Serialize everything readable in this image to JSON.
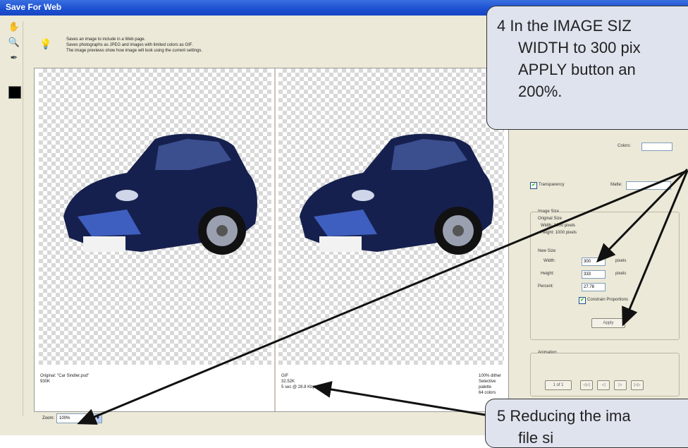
{
  "window": {
    "title": "Save For Web"
  },
  "info": {
    "lines": [
      "Saves an image to include in a Web page.",
      "Saves photographs as JPEG and images with limited colors as GIF.",
      "The image previews show how image will look using the current settings."
    ]
  },
  "preview": {
    "original": {
      "line1": "Original: \"Car Sindler.psd\"",
      "line2": "930K"
    },
    "optimized": {
      "line1": "GIF",
      "line2": "32.52K",
      "line3": "5 sec @ 28.8 Kbps"
    },
    "optimized_right": {
      "line1": "100% dither",
      "line2": "Selective palette",
      "line3": "64 colors"
    }
  },
  "settings": {
    "colors_label": "Colors:",
    "transparency_label": "Transparency",
    "matte_label": "Matte:",
    "image_size_label": "Image Size",
    "original_size_label": "Original Size",
    "orig_width": "Width: 1000 pixels",
    "orig_height": "Height: 1000 pixels",
    "new_size_label": "New Size",
    "width_label": "Width:",
    "width_value": "300",
    "height_label": "Height:",
    "height_value": "333",
    "percent_label": "Percent:",
    "percent_value": "27.78",
    "pixels_unit": "pixels",
    "constrain_label": "Constrain Proportions",
    "apply_button": "Apply",
    "animation_label": "Animation",
    "frame_label": "1 of 1"
  },
  "zoom": {
    "label": "Zoom:",
    "value": "100%"
  },
  "callouts": {
    "step4": {
      "line1": "4 In the IMAGE SIZ",
      "line2": "WIDTH to 300 pix",
      "line3": "APPLY button an",
      "line4": "200%."
    },
    "step5": {
      "line1": "5 Reducing the ima",
      "line2": "file si"
    }
  },
  "colors": {
    "titlebar": "#1b4fd1",
    "callout_bg": "#dfe3ee",
    "car": "#16204e"
  }
}
